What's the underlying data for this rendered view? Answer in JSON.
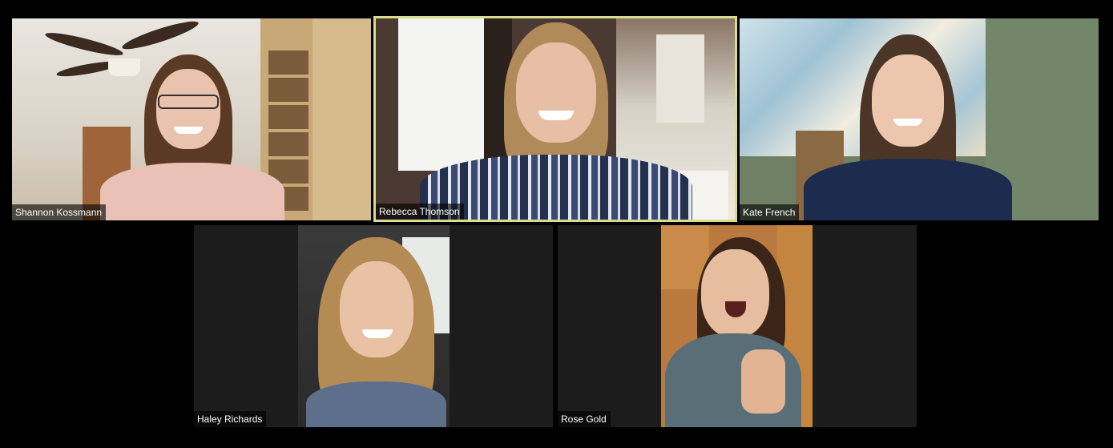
{
  "meeting": {
    "participants": [
      {
        "name": "Shannon Kossmann",
        "active_speaker": false
      },
      {
        "name": "Rebecca Thomson",
        "active_speaker": true
      },
      {
        "name": "Kate French",
        "active_speaker": false
      },
      {
        "name": "Haley Richards",
        "active_speaker": false
      },
      {
        "name": "Rose Gold",
        "active_speaker": false
      }
    ]
  },
  "colors": {
    "background": "#000000",
    "tile_background": "#1c1c1c",
    "active_speaker_border": "#d8dc8e",
    "label_text": "#ffffff"
  }
}
